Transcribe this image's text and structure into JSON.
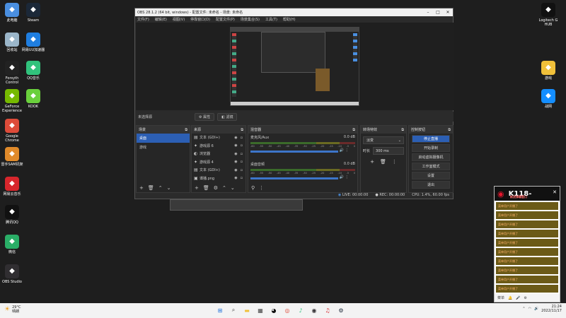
{
  "desktop_left": [
    {
      "label": "此电脑",
      "icon": "computer-icon",
      "color": "#4a8fe0"
    },
    {
      "label": "Steam",
      "icon": "steam-icon",
      "color": "#1b2838"
    },
    {
      "label": "回收站",
      "icon": "recycle-bin-icon",
      "color": "#9bb6c9"
    },
    {
      "label": "网易UU加速器",
      "icon": "uu-booster-icon",
      "color": "#1f7ee0"
    },
    {
      "label": "Forsyth Control",
      "icon": "forsyth-control-icon",
      "color": "#222"
    },
    {
      "label": "QQ音乐",
      "icon": "qq-music-icon",
      "color": "#31c27c"
    },
    {
      "label": "GeForce Experience",
      "icon": "geforce-icon",
      "color": "#76b900"
    },
    {
      "label": "KOOK",
      "icon": "kook-icon",
      "color": "#6ad03c"
    },
    {
      "label": "Google Chrome",
      "icon": "chrome-icon",
      "color": "#dd4b39"
    },
    {
      "label": "雷手SAM机架",
      "icon": "sam-rack-icon",
      "color": "#e08a2a"
    },
    {
      "label": "网易云音乐",
      "icon": "netease-music-icon",
      "color": "#d7262c"
    },
    {
      "label": "腾讯QQ",
      "icon": "qq-icon",
      "color": "#111"
    },
    {
      "label": "微信",
      "icon": "wechat-icon",
      "color": "#2aae67"
    },
    {
      "label": "OBS Studio",
      "icon": "obs-icon",
      "color": "#302e31"
    }
  ],
  "desktop_right": [
    {
      "label": "Logitech G HUB",
      "icon": "logitech-icon",
      "color": "#111"
    },
    {
      "label": "游戏",
      "icon": "folder-icon",
      "color": "#f0c03a"
    },
    {
      "label": "战网",
      "icon": "battlenet-icon",
      "color": "#148eff"
    }
  ],
  "obs": {
    "title": "OBS 28.1.2 (64 bit, windows) - 配置文件: 未命名 - 场景: 未命名",
    "menu": [
      "文件(F)",
      "编辑(E)",
      "视图(V)",
      "停靠窗口(D)",
      "配置文件(P)",
      "场景集合(S)",
      "工具(T)",
      "帮助(H)"
    ],
    "no_source": "未选择源",
    "props_btn": "属性",
    "filter_btn": "滤镜",
    "scenes_title": "场景",
    "scenes": [
      "桌面",
      "游戏"
    ],
    "sources_title": "来源",
    "sources": [
      {
        "name": "文本 (GDI+)",
        "icon": "text-icon"
      },
      {
        "name": "游戏源 6",
        "icon": "gamepad-icon"
      },
      {
        "name": "浏览器",
        "icon": "browser-icon"
      },
      {
        "name": "游戏源 4",
        "icon": "gamepad-icon"
      },
      {
        "name": "文本 (GDI+)",
        "icon": "text-icon"
      },
      {
        "name": "谭播.png",
        "icon": "image-icon"
      }
    ],
    "mixer_title": "混音器",
    "mixer": [
      {
        "name": "麦克风/Aux",
        "level": "0.0 dB"
      },
      {
        "name": "桌面音频",
        "level": "0.0 dB"
      }
    ],
    "scale": [
      "-60",
      "-55",
      "-50",
      "-45",
      "-40",
      "-35",
      "-30",
      "-25",
      "-20",
      "-15",
      "-10",
      "-5",
      "0"
    ],
    "transitions_title": "转场特效",
    "transition": "淡变",
    "duration_label": "时长",
    "duration": "300 ms",
    "controls_title": "控制按钮",
    "controls": [
      "停止直播",
      "开始录制",
      "启动虚拟摄像机",
      "工作室模式",
      "设置",
      "退出"
    ],
    "live": "LIVE: 00:00:00",
    "rec": "REC: 00:00:00",
    "cpu": "CPU: 1.4%, 60.00 fps"
  },
  "weibo": {
    "id": "K118-",
    "subtitle": "新浪弹幕窗口",
    "items": [
      "菜单用户开播了",
      "菜单用户开播了",
      "菜单用户开播了",
      "菜单用户开播了",
      "菜单用户开播了",
      "菜单用户开播了",
      "菜单用户开播了",
      "菜单用户开播了",
      "菜单用户开播了",
      "菜单用户开播了",
      "菜单用户开播了",
      "菜单用户开播了"
    ],
    "footer": "菜单"
  },
  "taskbar": {
    "weather_temp": "29°C",
    "weather_text": "晴朗",
    "time": "21:24",
    "date": "2022/11/17",
    "apps": [
      {
        "icon": "windows-start-icon",
        "color": "#1e6fd9"
      },
      {
        "icon": "search-icon",
        "color": "#444"
      },
      {
        "icon": "file-explorer-icon",
        "color": "#f0c03a"
      },
      {
        "icon": "store-icon",
        "color": "#444"
      },
      {
        "icon": "qq-icon",
        "color": "#111"
      },
      {
        "icon": "chrome-icon",
        "color": "#dd4b39"
      },
      {
        "icon": "qq-music-icon",
        "color": "#31c27c"
      },
      {
        "icon": "obs-icon",
        "color": "#302e31"
      },
      {
        "icon": "netease-music-icon",
        "color": "#d7262c"
      },
      {
        "icon": "steam-icon",
        "color": "#1b2838"
      }
    ]
  }
}
